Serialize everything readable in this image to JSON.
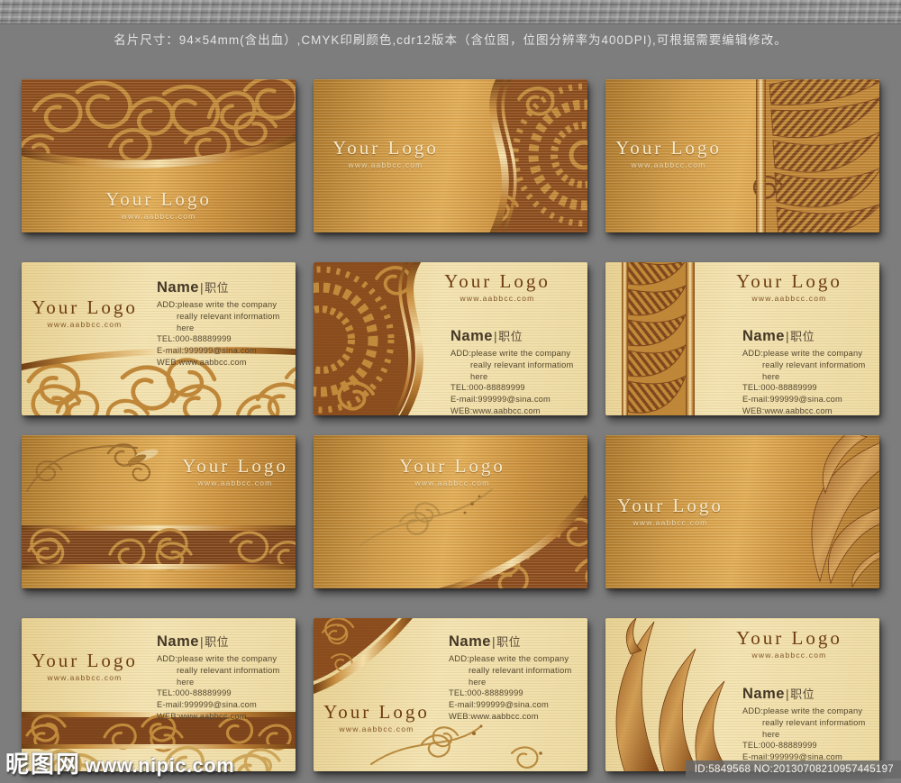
{
  "header": {
    "spec_text": "名片尺寸：94×54mm(含出血）,CMYK印刷颜色,cdr12版本（含位图，位图分辨率为400DPI),可根据需要编辑修改。"
  },
  "card_common": {
    "logo": "Your Logo",
    "website": "www.aabbcc.com",
    "name": "Name",
    "title_separator": "|",
    "title_suffix": "职位",
    "contact": {
      "add_line1": "ADD:please write the company",
      "add_line2": "really relevant informatiom",
      "add_line3": "here",
      "tel": "TEL:000-88889999",
      "email": "E-mail:999999@sina.com",
      "web": "WEB:www.aabbcc.com"
    }
  },
  "cards": [
    {
      "index": 1,
      "side": "front"
    },
    {
      "index": 2,
      "side": "front"
    },
    {
      "index": 3,
      "side": "front"
    },
    {
      "index": 4,
      "side": "back"
    },
    {
      "index": 5,
      "side": "back"
    },
    {
      "index": 6,
      "side": "back"
    },
    {
      "index": 7,
      "side": "front"
    },
    {
      "index": 8,
      "side": "front"
    },
    {
      "index": 9,
      "side": "front"
    },
    {
      "index": 10,
      "side": "back"
    },
    {
      "index": 11,
      "side": "back"
    },
    {
      "index": 12,
      "side": "back"
    }
  ],
  "watermark": {
    "site_name": "昵图网",
    "site_url": "www.nipic.com"
  },
  "footer_id": "ID:5849568 NO:20130708210957445197",
  "colors": {
    "page_background": "#7d7d7d",
    "gold_card": "#cf9a46",
    "cream_card": "#f2e3b0",
    "dark_ornament": "#8a4b1d",
    "ornament_gold": "#c28b3c",
    "metallic_highlight": "#f7e3ae",
    "logo_light": "#f4e8c8",
    "logo_dark": "#6f3e12"
  }
}
